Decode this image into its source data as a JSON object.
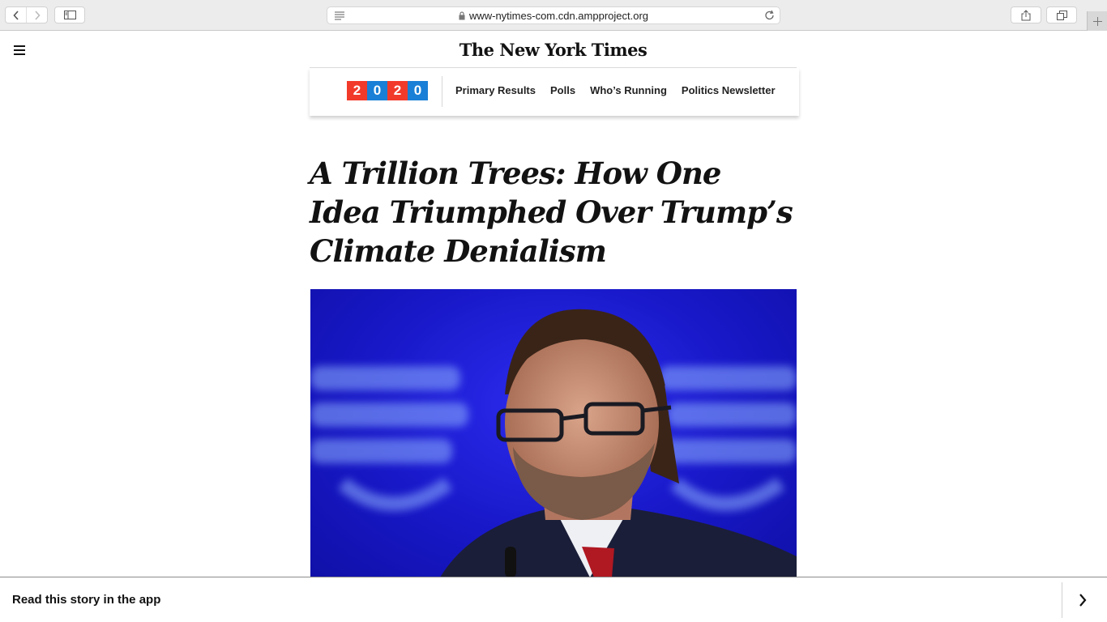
{
  "browser": {
    "url": "www-nytimes-com.cdn.ampproject.org",
    "icons": [
      "chevron-left-icon",
      "chevron-right-icon",
      "sidebar-icon",
      "reader-icon",
      "lock-icon",
      "reload-icon",
      "share-icon",
      "tabs-icon",
      "plus-icon"
    ]
  },
  "site": {
    "logo_text": "The New York Times"
  },
  "subnav": {
    "badge_digits": [
      "2",
      "0",
      "2",
      "0"
    ],
    "badge_colors": [
      "#f23a2a",
      "#1a7fd6",
      "#f23a2a",
      "#1a7fd6"
    ],
    "links": [
      "Primary Results",
      "Polls",
      "Who’s Running",
      "Politics Newsletter"
    ]
  },
  "article": {
    "headline": "A Trillion Trees: How One Idea  Triumphed Over Trump’s Climate Denialism",
    "photo_background": "#1818c8"
  },
  "app_banner": {
    "label": "Read this story in the app"
  }
}
